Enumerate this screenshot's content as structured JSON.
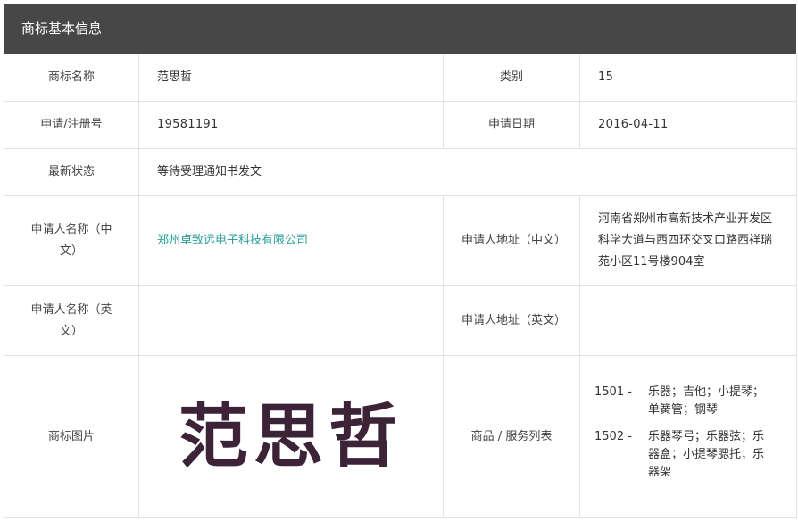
{
  "header": {
    "title": "商标基本信息"
  },
  "rows": {
    "name": {
      "label": "商标名称",
      "value": "范思哲"
    },
    "category": {
      "label": "类别",
      "value": "15"
    },
    "reg_no": {
      "label": "申请/注册号",
      "value": "19581191"
    },
    "app_date": {
      "label": "申请日期",
      "value": "2016-04-11"
    },
    "status": {
      "label": "最新状态",
      "value": "等待受理通知书发文"
    },
    "applicant_cn": {
      "label": "申请人名称（中文）",
      "value": "郑州卓致远电子科技有限公司"
    },
    "address_cn": {
      "label": "申请人地址（中文）",
      "value": "河南省郑州市高新技术产业开发区科学大道与西四环交叉口路西祥瑞苑小区11号楼904室"
    },
    "applicant_en": {
      "label": "申请人名称（英文）",
      "value": ""
    },
    "address_en": {
      "label": "申请人地址（英文）",
      "value": ""
    },
    "image": {
      "label": "商标图片",
      "mark_text": "范思哲"
    },
    "goods": {
      "label": "商品 / 服务列表",
      "items": [
        {
          "code": "1501 -",
          "text": "乐器；吉他；小提琴；单簧管；钢琴"
        },
        {
          "code": "1502 -",
          "text": "乐器琴弓；乐器弦；乐器盒；小提琴腮托；乐器架"
        }
      ]
    }
  }
}
